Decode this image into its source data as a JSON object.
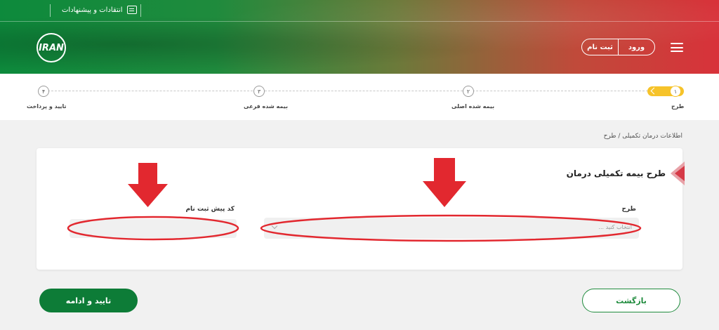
{
  "header": {
    "feedback_label": "انتقادات و پیشنهادات",
    "feedback_icon": "chat-bubble-icon",
    "logo_text": "IRAN",
    "login_label": "ورود",
    "signup_label": "ثبت نام",
    "menu_icon": "hamburger-icon"
  },
  "stepper": {
    "steps": [
      {
        "number": "۱",
        "label": "طرح",
        "state": "active"
      },
      {
        "number": "۲",
        "label": "بیمه شده اصلی",
        "state": "pending"
      },
      {
        "number": "۳",
        "label": "بیمه شده فرعی",
        "state": "pending"
      },
      {
        "number": "۴",
        "label": "تایید و پرداخت",
        "state": "pending"
      }
    ],
    "active_color": "#f6c32a"
  },
  "breadcrumb": "اطلاعات درمان تکمیلی /  طرح",
  "form": {
    "title": "طرح بیمه تکمیلی درمان",
    "plan_label": "طرح",
    "plan_placeholder": "انتخاب کنید ...",
    "precode_label": "کد پیش ثبت نام",
    "precode_value": ""
  },
  "buttons": {
    "back": "بازگشت",
    "confirm": "تایید و ادامه"
  },
  "colors": {
    "brand_green": "#0d7c37",
    "annotation_red": "#e2282f"
  }
}
